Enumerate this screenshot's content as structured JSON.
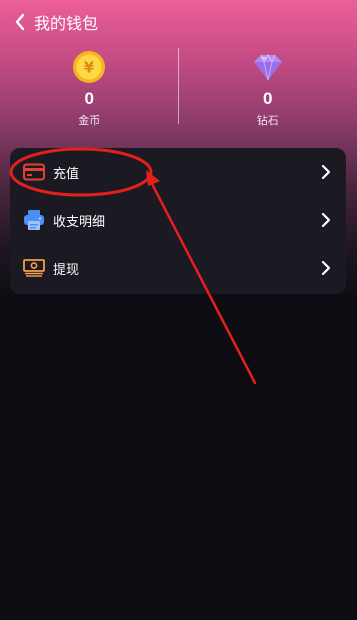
{
  "header": {
    "back_icon": "chevron-left-icon",
    "title": "我的钱包"
  },
  "balances": [
    {
      "icon": "coin-icon",
      "coin_symbol": "¥",
      "value": "0",
      "label": "金币"
    },
    {
      "icon": "diamond-icon",
      "value": "0",
      "label": "钻石"
    }
  ],
  "menu": [
    {
      "icon": "card-icon",
      "label": "充值",
      "accent": "#e8402f"
    },
    {
      "icon": "printer-icon",
      "label": "收支明细",
      "accent": "#4b8ef5"
    },
    {
      "icon": "cash-icon",
      "label": "提现",
      "accent": "#f2a04a"
    }
  ],
  "colors": {
    "gradient_top": "#ec5f97",
    "background": "#0d0c12",
    "card": "#1b1a23",
    "annotation": "#e3201b"
  }
}
